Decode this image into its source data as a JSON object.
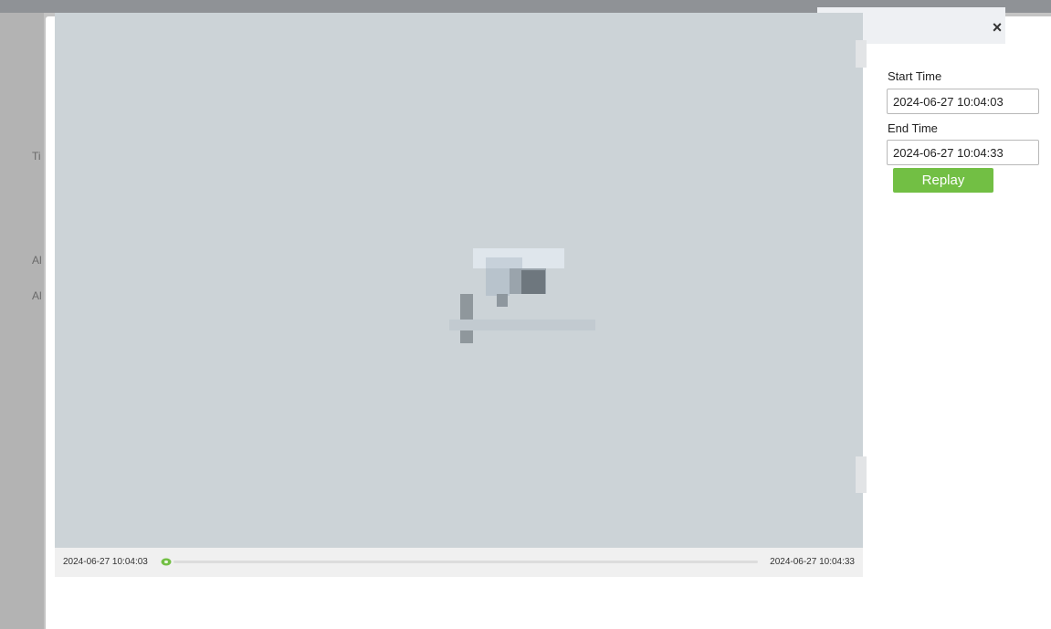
{
  "background": {
    "labels": [
      "Ti",
      "Al",
      "Al"
    ]
  },
  "dialog": {
    "close_icon": "×"
  },
  "video": {
    "icon": "camera-icon",
    "timeline": {
      "start": "2024-06-27 10:04:03",
      "end": "2024-06-27 10:04:33",
      "progress": 0
    }
  },
  "panel": {
    "start_label": "Start Time",
    "start_value": "2024-06-27 10:04:03",
    "end_label": "End Time",
    "end_value": "2024-06-27 10:04:33",
    "replay_label": "Replay"
  },
  "colors": {
    "accent": "#72bf44",
    "video_bg": "#ccd3d7"
  }
}
